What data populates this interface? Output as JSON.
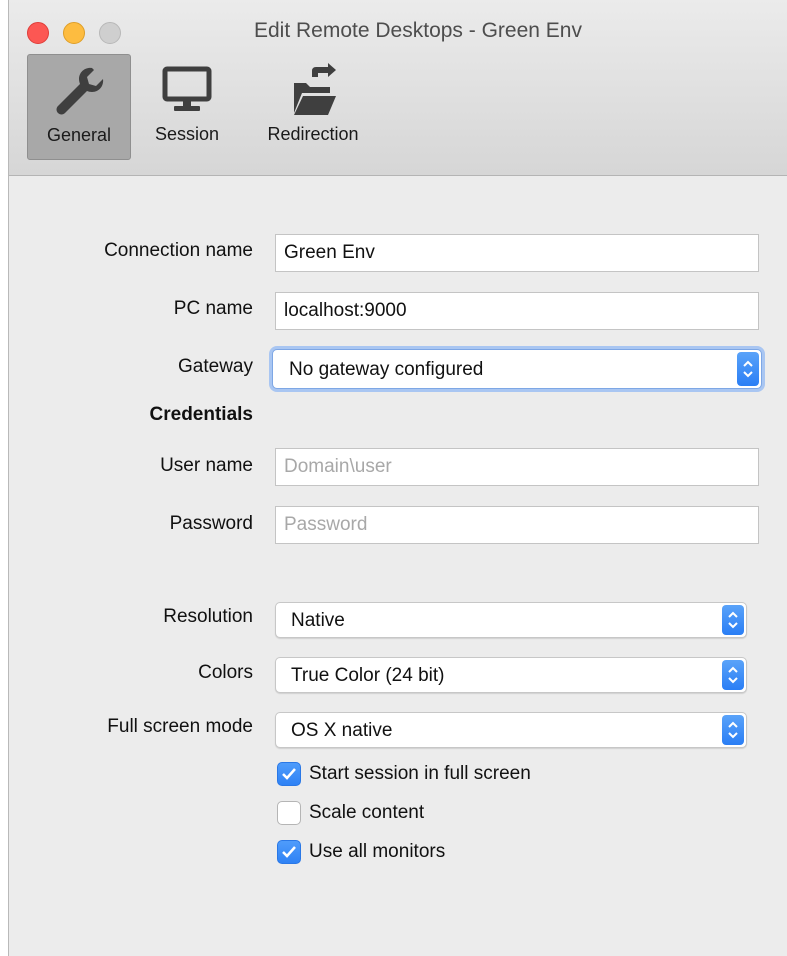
{
  "window": {
    "title": "Edit Remote Desktops - Green Env"
  },
  "toolbar": {
    "tabs": [
      {
        "label": "General",
        "icon": "wrench-icon",
        "active": true
      },
      {
        "label": "Session",
        "icon": "monitor-icon",
        "active": false
      },
      {
        "label": "Redirection",
        "icon": "folder-redirect-icon",
        "active": false
      }
    ]
  },
  "form": {
    "connection_name": {
      "label": "Connection name",
      "value": "Green Env"
    },
    "pc_name": {
      "label": "PC name",
      "value": "localhost:9000"
    },
    "gateway": {
      "label": "Gateway",
      "value": "No gateway configured"
    },
    "credentials_heading": "Credentials",
    "user_name": {
      "label": "User name",
      "value": "",
      "placeholder": "Domain\\user"
    },
    "password": {
      "label": "Password",
      "value": "",
      "placeholder": "Password"
    },
    "resolution": {
      "label": "Resolution",
      "value": "Native"
    },
    "colors": {
      "label": "Colors",
      "value": "True Color (24 bit)"
    },
    "full_screen_mode": {
      "label": "Full screen mode",
      "value": "OS X native"
    },
    "checkboxes": [
      {
        "label": "Start session in full screen",
        "checked": true
      },
      {
        "label": "Scale content",
        "checked": false
      },
      {
        "label": "Use all monitors",
        "checked": true
      }
    ]
  },
  "colors": {
    "accent": "#2f82f5",
    "close": "#fc5753",
    "minimize": "#fdbc40",
    "maximize_disabled": "#cfcfcf",
    "focus_ring": "#a9c6f2"
  }
}
